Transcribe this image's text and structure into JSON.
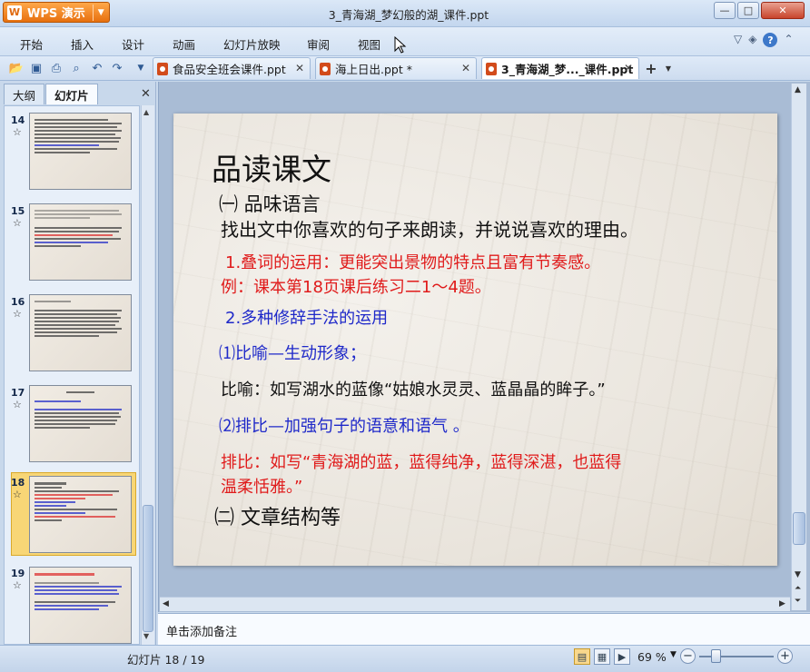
{
  "app": {
    "name": "WPS 演示",
    "window_title": "3_青海湖_梦幻般的湖_课件.ppt"
  },
  "menu": [
    "开始",
    "插入",
    "设计",
    "动画",
    "幻灯片放映",
    "审阅",
    "视图"
  ],
  "tabs": [
    {
      "label": "食品安全班会课件.ppt"
    },
    {
      "label": "海上日出.ppt *"
    },
    {
      "label": "3_青海湖_梦..._课件.ppt"
    }
  ],
  "left_pane": {
    "tabs": [
      "大纲",
      "幻灯片"
    ],
    "thumbnails": [
      {
        "num": "14",
        "star": "☆"
      },
      {
        "num": "15",
        "star": "☆"
      },
      {
        "num": "16",
        "star": "☆"
      },
      {
        "num": "17",
        "star": "☆"
      },
      {
        "num": "18",
        "star": "☆"
      },
      {
        "num": "19",
        "star": "☆"
      }
    ]
  },
  "slide": {
    "title": "品读课文",
    "lines": [
      "㈠ 品味语言",
      "找出文中你喜欢的句子来朗读，并说说喜欢的理由。",
      "1.叠词的运用：更能突出景物的特点且富有节奏感。",
      "例：课本第18页课后练习二1～4题。",
      "2.多种修辞手法的运用",
      "⑴比喻—生动形象；",
      "比喻：如写湖水的蓝像“姑娘水灵灵、蓝晶晶的眸子。”",
      "⑵排比—加强句子的语意和语气  。",
      "排比：如写“青海湖的蓝，蓝得纯净，蓝得深湛，也蓝得",
      "温柔恬雅。”",
      "㈡ 文章结构等"
    ]
  },
  "notes_placeholder": "单击添加备注",
  "status": {
    "slide_indicator": "幻灯片 18 / 19",
    "zoom": "69 %"
  },
  "colors": {
    "accent_orange": "#e7700f",
    "slide_red": "#e01b1b",
    "slide_blue": "#1f29c9",
    "selected_thumb": "#f8d676"
  }
}
